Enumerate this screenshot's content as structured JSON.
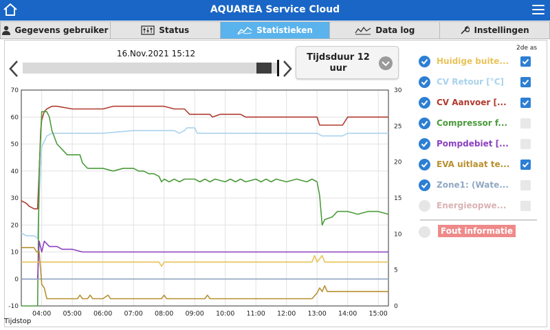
{
  "app": {
    "title": "AQUAREA Service Cloud"
  },
  "tabs": [
    {
      "label": "Gegevens gebruiker",
      "icon": "user-icon"
    },
    {
      "label": "Status",
      "icon": "status-gauge-icon"
    },
    {
      "label": "Statistieken",
      "icon": "chart-line-icon"
    },
    {
      "label": "Data log",
      "icon": "data-log-icon"
    },
    {
      "label": "Instellingen",
      "icon": "wrench-icon"
    }
  ],
  "active_tab": "Statistieken",
  "viewer": {
    "datetime": "16.Nov.2021 15:12",
    "duration_label": "Tijdsduur 12 uur",
    "slider_fraction": 0.97
  },
  "legend": {
    "header": "2de as",
    "items": [
      {
        "label": "Huidige buite...",
        "color": "#e8c35a",
        "checked": true,
        "second_axis": true
      },
      {
        "label": "CV Retour [°C]",
        "color": "#a9d2ec",
        "checked": true,
        "second_axis": true
      },
      {
        "label": "CV Aanvoer [...",
        "color": "#b03a2e",
        "checked": true,
        "second_axis": true
      },
      {
        "label": "Compressor f...",
        "color": "#4a9a3a",
        "checked": true,
        "second_axis": false
      },
      {
        "label": "Pompdebiet [...",
        "color": "#8a3fc0",
        "checked": true,
        "second_axis": false
      },
      {
        "label": "EVA uitlaat te...",
        "color": "#b8902e",
        "checked": true,
        "second_axis": true
      },
      {
        "label": "Zone1: (Wate...",
        "color": "#90a8c4",
        "checked": true,
        "second_axis": false
      },
      {
        "label": "Energieopwe...",
        "color": "#dbb3b3",
        "checked": false,
        "second_axis": false
      }
    ],
    "fault_label": "Fout informatie"
  },
  "footer": {
    "x_axis_label": "Tijdstop"
  },
  "colors": {
    "header": "#1a66c6",
    "active_tab": "#5ab3ec",
    "check": "#2d7fd3"
  },
  "chart_data": {
    "type": "line",
    "x_ticks": [
      "04:00",
      "05:00",
      "06:00",
      "07:00",
      "08:00",
      "09:00",
      "10:00",
      "11:00",
      "12:00",
      "13:00",
      "14:00",
      "15:00"
    ],
    "x_range": [
      "03:20",
      "15:20"
    ],
    "xlabel": "Tijdstop",
    "y_left": {
      "range": [
        -10,
        70
      ],
      "ticks": [
        -10,
        0,
        10,
        20,
        30,
        40,
        50,
        60,
        70
      ]
    },
    "y_right": {
      "range": [
        0,
        30
      ],
      "ticks": [
        0,
        5,
        10,
        15,
        20,
        25,
        30
      ]
    },
    "grid": true,
    "series": [
      {
        "name": "CV Aanvoer [...",
        "color": "#b03a2e",
        "axis": "left",
        "points": [
          [
            "03:20",
            29
          ],
          [
            "03:30",
            28
          ],
          [
            "03:35",
            27
          ],
          [
            "03:45",
            26
          ],
          [
            "03:52",
            26
          ],
          [
            "03:55",
            40
          ],
          [
            "03:58",
            55
          ],
          [
            "04:00",
            59
          ],
          [
            "04:05",
            62
          ],
          [
            "04:10",
            63
          ],
          [
            "04:20",
            64
          ],
          [
            "04:30",
            64
          ],
          [
            "05:00",
            63
          ],
          [
            "06:00",
            63
          ],
          [
            "06:20",
            64
          ],
          [
            "07:00",
            64
          ],
          [
            "08:00",
            64
          ],
          [
            "08:20",
            63
          ],
          [
            "08:40",
            63
          ],
          [
            "08:50",
            61
          ],
          [
            "09:30",
            61
          ],
          [
            "09:35",
            60
          ],
          [
            "09:50",
            61
          ],
          [
            "10:30",
            61
          ],
          [
            "10:40",
            60
          ],
          [
            "11:00",
            60
          ],
          [
            "12:00",
            60
          ],
          [
            "12:50",
            60
          ],
          [
            "13:00",
            60
          ],
          [
            "13:05",
            57
          ],
          [
            "13:30",
            57
          ],
          [
            "13:50",
            57
          ],
          [
            "14:00",
            60
          ],
          [
            "15:20",
            60
          ]
        ]
      },
      {
        "name": "CV Retour [°C]",
        "color": "#a9d2ec",
        "axis": "left",
        "points": [
          [
            "03:20",
            17
          ],
          [
            "03:30",
            16
          ],
          [
            "03:45",
            16
          ],
          [
            "03:52",
            15
          ],
          [
            "03:55",
            30
          ],
          [
            "04:00",
            49
          ],
          [
            "04:05",
            51
          ],
          [
            "04:10",
            53
          ],
          [
            "04:20",
            54
          ],
          [
            "05:00",
            54
          ],
          [
            "06:00",
            54
          ],
          [
            "07:00",
            55
          ],
          [
            "08:00",
            55
          ],
          [
            "08:20",
            55
          ],
          [
            "08:30",
            54
          ],
          [
            "08:40",
            55
          ],
          [
            "08:45",
            56
          ],
          [
            "09:00",
            56
          ],
          [
            "09:05",
            54
          ],
          [
            "10:00",
            54
          ],
          [
            "11:00",
            54
          ],
          [
            "12:00",
            54
          ],
          [
            "13:00",
            54
          ],
          [
            "13:10",
            53
          ],
          [
            "13:30",
            53
          ],
          [
            "13:50",
            53
          ],
          [
            "14:00",
            54
          ],
          [
            "15:20",
            54
          ]
        ]
      },
      {
        "name": "Compressor f...",
        "color": "#4a9a3a",
        "axis": "left",
        "points": [
          [
            "03:20",
            -10
          ],
          [
            "03:52",
            -10
          ],
          [
            "03:55",
            40
          ],
          [
            "04:00",
            62
          ],
          [
            "04:10",
            62
          ],
          [
            "04:15",
            60
          ],
          [
            "04:20",
            55
          ],
          [
            "04:30",
            50
          ],
          [
            "04:40",
            48
          ],
          [
            "04:50",
            46
          ],
          [
            "05:00",
            46
          ],
          [
            "05:15",
            46
          ],
          [
            "05:20",
            43
          ],
          [
            "05:30",
            41
          ],
          [
            "06:00",
            41
          ],
          [
            "06:20",
            40
          ],
          [
            "06:40",
            41
          ],
          [
            "07:00",
            41
          ],
          [
            "07:10",
            40
          ],
          [
            "07:20",
            40
          ],
          [
            "07:30",
            39
          ],
          [
            "07:40",
            39
          ],
          [
            "07:50",
            38
          ],
          [
            "07:55",
            36
          ],
          [
            "08:00",
            37
          ],
          [
            "08:10",
            36
          ],
          [
            "08:20",
            37
          ],
          [
            "08:30",
            36
          ],
          [
            "08:40",
            37
          ],
          [
            "09:00",
            37
          ],
          [
            "09:10",
            36
          ],
          [
            "09:20",
            37
          ],
          [
            "09:30",
            36
          ],
          [
            "09:40",
            37
          ],
          [
            "10:00",
            36
          ],
          [
            "10:10",
            37
          ],
          [
            "10:20",
            36
          ],
          [
            "10:30",
            37
          ],
          [
            "10:40",
            36
          ],
          [
            "11:00",
            37
          ],
          [
            "11:10",
            36
          ],
          [
            "11:20",
            37
          ],
          [
            "11:30",
            36
          ],
          [
            "11:40",
            37
          ],
          [
            "12:00",
            36
          ],
          [
            "12:20",
            37
          ],
          [
            "12:40",
            36
          ],
          [
            "12:50",
            37
          ],
          [
            "13:00",
            36
          ],
          [
            "13:05",
            31
          ],
          [
            "13:10",
            20
          ],
          [
            "13:15",
            22
          ],
          [
            "13:30",
            23
          ],
          [
            "13:40",
            25
          ],
          [
            "14:00",
            25
          ],
          [
            "14:20",
            24
          ],
          [
            "14:40",
            25
          ],
          [
            "15:00",
            25
          ],
          [
            "15:20",
            24
          ]
        ]
      },
      {
        "name": "Pompdebiet [...",
        "color": "#8a3fc0",
        "axis": "left",
        "points": [
          [
            "03:20",
            0
          ],
          [
            "03:52",
            0
          ],
          [
            "03:55",
            14
          ],
          [
            "04:00",
            10
          ],
          [
            "04:05",
            14
          ],
          [
            "04:15",
            12
          ],
          [
            "04:30",
            12
          ],
          [
            "04:40",
            11
          ],
          [
            "05:00",
            11
          ],
          [
            "05:20",
            10
          ],
          [
            "06:00",
            10
          ],
          [
            "07:00",
            10
          ],
          [
            "08:00",
            10
          ],
          [
            "09:00",
            10
          ],
          [
            "10:00",
            10
          ],
          [
            "11:00",
            10
          ],
          [
            "12:00",
            10
          ],
          [
            "13:00",
            10
          ],
          [
            "14:00",
            10
          ],
          [
            "15:20",
            10
          ]
        ]
      },
      {
        "name": "Zone1: (Wate...",
        "color": "#90a8c4",
        "axis": "left",
        "points": [
          [
            "03:20",
            0
          ],
          [
            "13:00",
            0
          ],
          [
            "13:05",
            0
          ],
          [
            "15:20",
            0
          ]
        ]
      },
      {
        "name": "Huidige buite...",
        "color": "#e8c35a",
        "axis": "right",
        "points": [
          [
            "03:20",
            6.1
          ],
          [
            "05:00",
            6.1
          ],
          [
            "06:00",
            6.1
          ],
          [
            "07:00",
            6.1
          ],
          [
            "07:50",
            6.1
          ],
          [
            "07:55",
            5.5
          ],
          [
            "08:00",
            6.1
          ],
          [
            "09:00",
            6.1
          ],
          [
            "10:00",
            6.1
          ],
          [
            "11:00",
            6.1
          ],
          [
            "12:00",
            6.1
          ],
          [
            "12:50",
            6.1
          ],
          [
            "12:55",
            7.0
          ],
          [
            "13:00",
            6.1
          ],
          [
            "13:10",
            7.0
          ],
          [
            "13:15",
            6.1
          ],
          [
            "15:20",
            6.1
          ]
        ]
      },
      {
        "name": "EVA uitlaat te...",
        "color": "#b8902e",
        "axis": "right",
        "points": [
          [
            "03:20",
            8.1
          ],
          [
            "03:45",
            8.1
          ],
          [
            "03:50",
            7.5
          ],
          [
            "03:55",
            7.6
          ],
          [
            "04:00",
            3.0
          ],
          [
            "04:05",
            2.5
          ],
          [
            "04:10",
            1.0
          ],
          [
            "05:00",
            1.0
          ],
          [
            "05:10",
            1.0
          ],
          [
            "05:15",
            1.5
          ],
          [
            "05:20",
            1.0
          ],
          [
            "05:30",
            1.0
          ],
          [
            "05:35",
            1.5
          ],
          [
            "05:40",
            1.0
          ],
          [
            "06:00",
            1.0
          ],
          [
            "06:10",
            1.5
          ],
          [
            "06:15",
            1.0
          ],
          [
            "07:00",
            1.0
          ],
          [
            "07:55",
            1.0
          ],
          [
            "08:00",
            1.5
          ],
          [
            "08:05",
            1.0
          ],
          [
            "09:00",
            1.0
          ],
          [
            "09:20",
            1.0
          ],
          [
            "09:25",
            1.5
          ],
          [
            "09:30",
            1.0
          ],
          [
            "10:00",
            1.0
          ],
          [
            "11:00",
            1.0
          ],
          [
            "12:00",
            1.0
          ],
          [
            "12:50",
            1.0
          ],
          [
            "13:00",
            1.8
          ],
          [
            "13:05",
            2.5
          ],
          [
            "13:10",
            2.0
          ],
          [
            "13:15",
            2.8
          ],
          [
            "13:20",
            2.0
          ],
          [
            "15:20",
            2.0
          ]
        ]
      }
    ]
  }
}
